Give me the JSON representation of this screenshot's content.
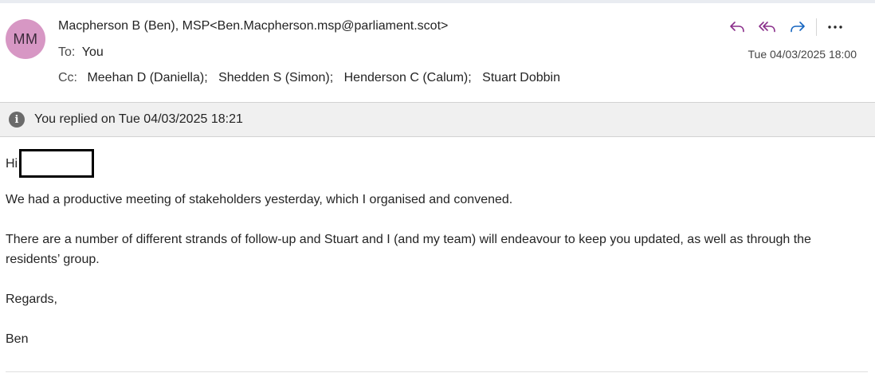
{
  "colors": {
    "avatar_bg": "#d797c4",
    "reply_icon": "#8a2e8a",
    "forward_icon": "#1565c0"
  },
  "header": {
    "avatar_initials": "MM",
    "sender_name": "Macpherson B (Ben), MSP",
    "sender_email": "<Ben.Macpherson.msp@parliament.scot>",
    "to_label": "To:",
    "to_value": "You",
    "cc_label": "Cc:",
    "cc_recipients": [
      "Meehan D (Daniella);",
      "Shedden S (Simon);",
      "Henderson C (Calum);",
      "Stuart Dobbin"
    ],
    "date": "Tue 04/03/2025 18:00",
    "actions": [
      {
        "name": "reply",
        "icon": "reply-icon"
      },
      {
        "name": "reply-all",
        "icon": "reply-all-icon"
      },
      {
        "name": "forward",
        "icon": "forward-icon"
      },
      {
        "name": "more",
        "icon": "more-icon"
      }
    ]
  },
  "info_bar": {
    "icon": "info-icon",
    "text": "You replied on Tue 04/03/2025 18:21"
  },
  "body": {
    "greeting": "Hi",
    "paragraphs": [
      "We had a productive meeting of stakeholders yesterday, which I organised and convened.",
      "There are a number of different strands of follow-up and Stuart and I (and my team) will endeavour to keep you updated, as well as through the residents’ group.",
      "Regards,",
      "Ben"
    ]
  }
}
